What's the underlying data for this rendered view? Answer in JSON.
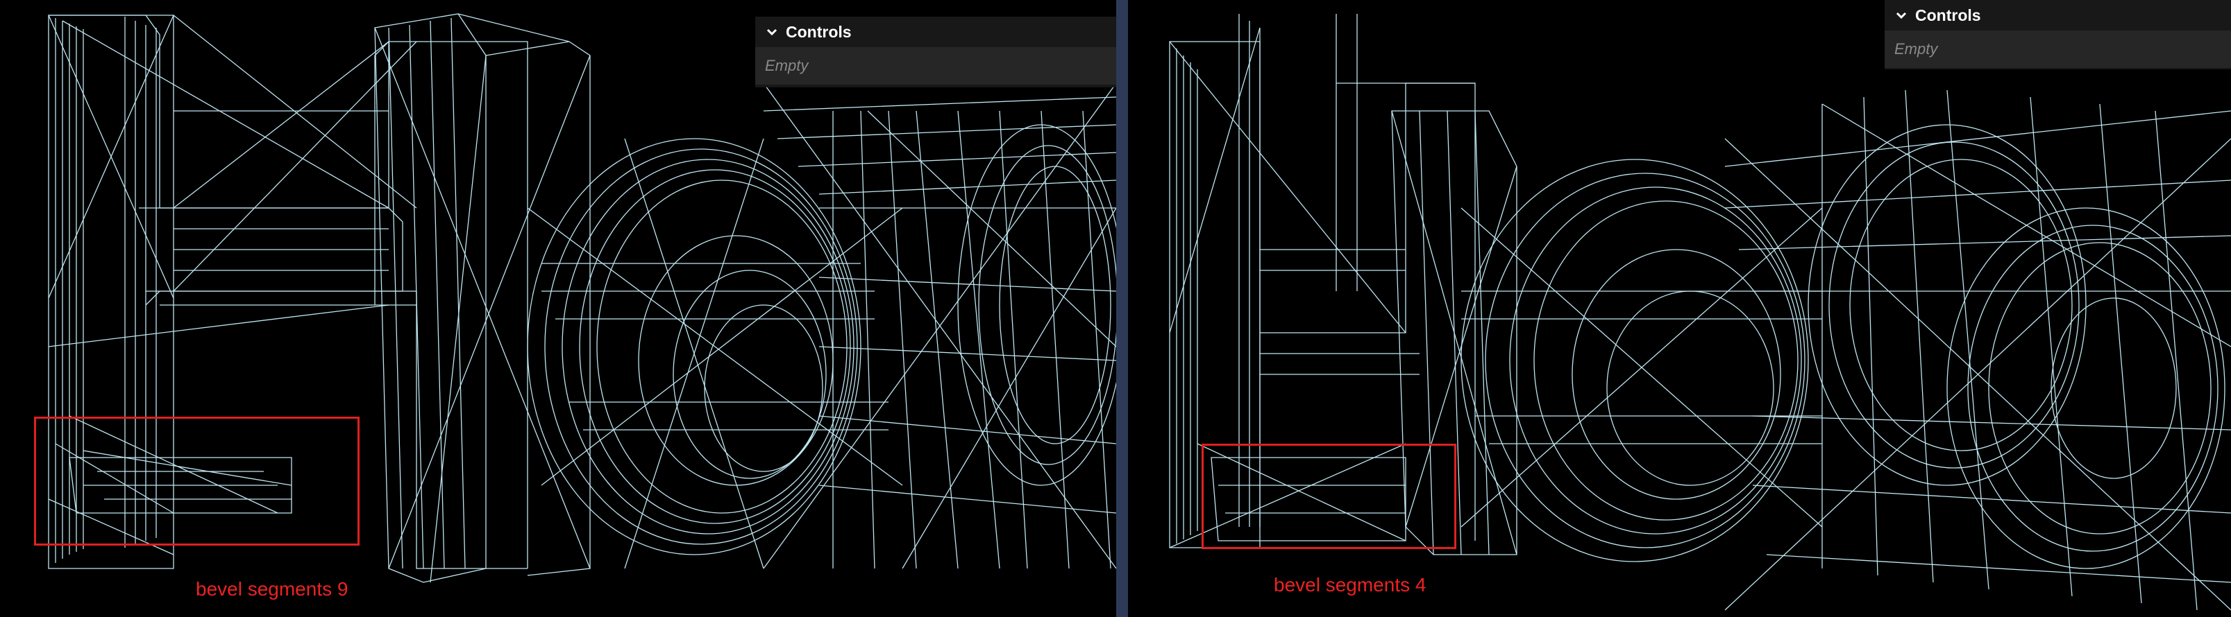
{
  "left_panel": {
    "controls": {
      "title": "Controls",
      "status": "Empty"
    },
    "annotation": "bevel segments 9"
  },
  "right_panel": {
    "controls": {
      "title": "Controls",
      "status": "Empty"
    },
    "annotation": "bevel segments 4"
  },
  "colors": {
    "wireframe": "#bfe6f2",
    "highlight": "#e02020",
    "caption": "#ee2222",
    "background": "#000000",
    "panel_header": "#181818",
    "panel_body": "#262626"
  },
  "icons": {
    "collapse": "chevron-down-icon"
  }
}
